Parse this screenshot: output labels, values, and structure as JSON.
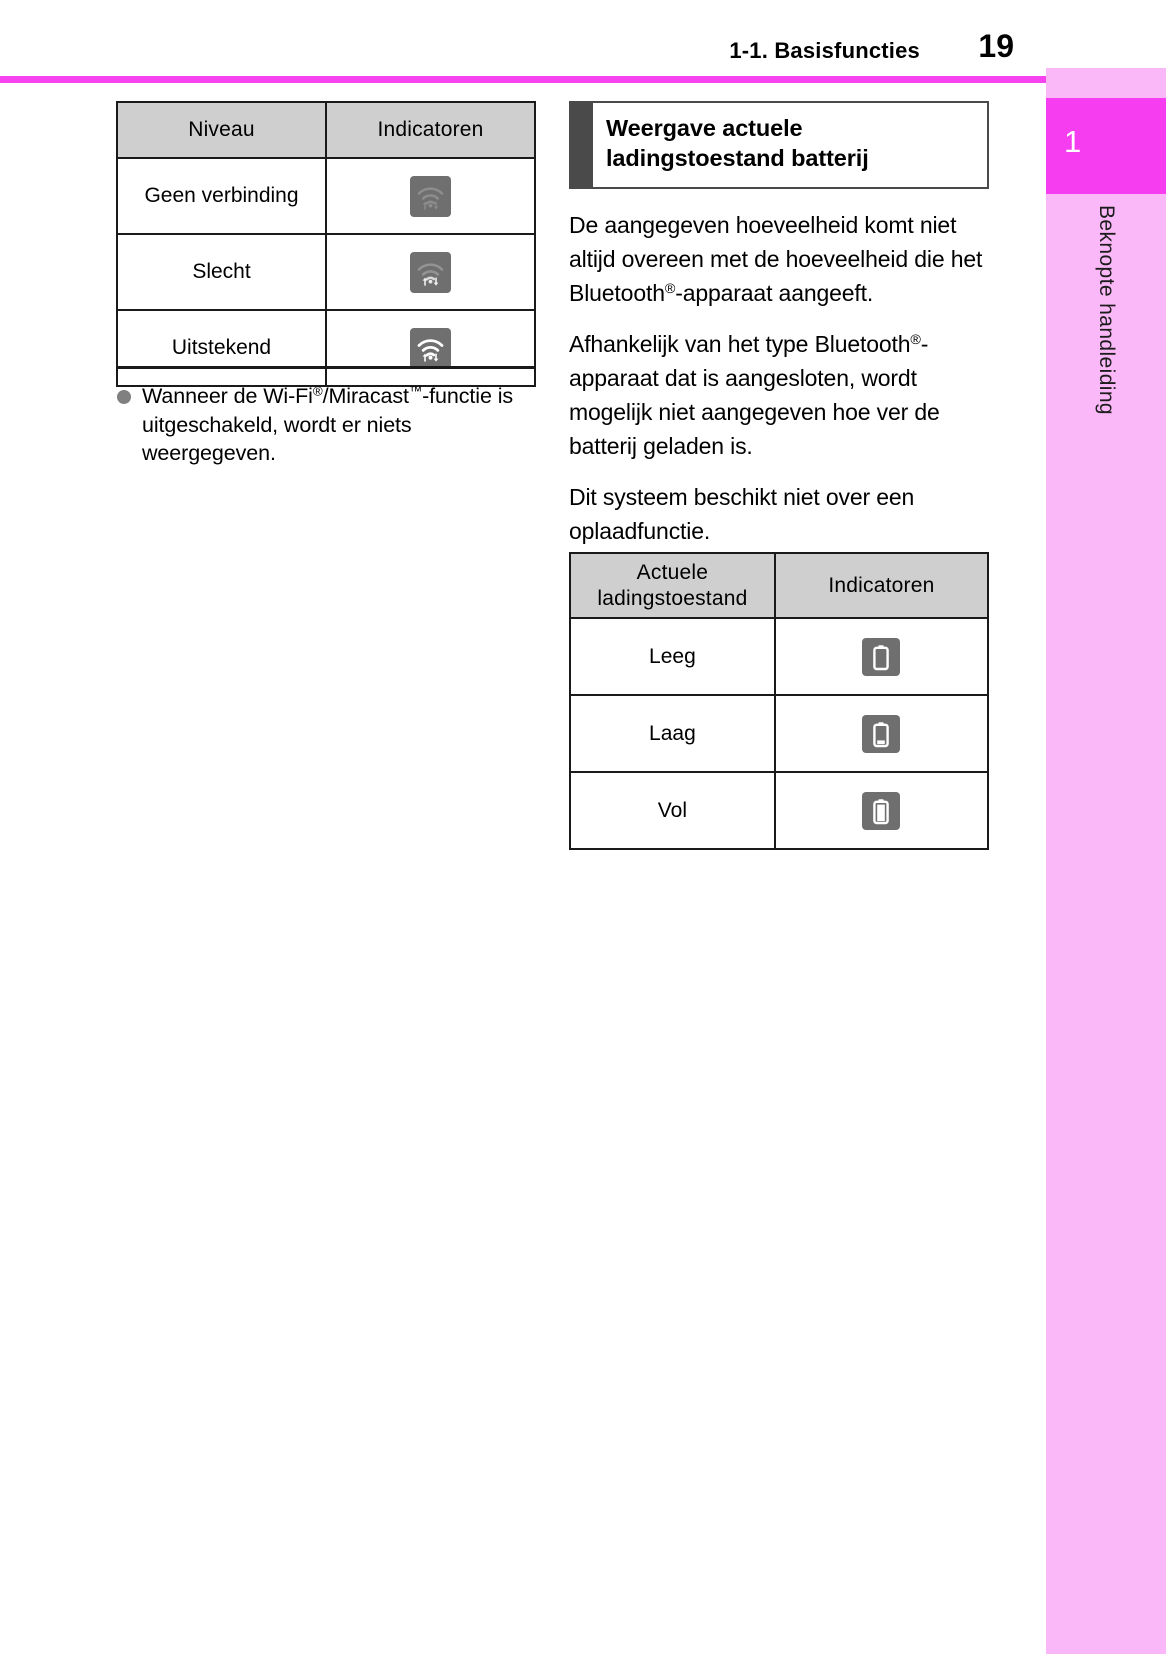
{
  "header": {
    "title": "1-1. Basisfuncties",
    "page_number": "19"
  },
  "sidebar": {
    "chapter_number": "1",
    "chapter_label": "Beknopte handleiding",
    "tab_color": "#f73df0",
    "strip_color": "#fbb8f8"
  },
  "left_column": {
    "table": {
      "headers": [
        "Niveau",
        "Indicatoren"
      ],
      "rows": [
        {
          "level": "Geen verbinding",
          "icon": "wifi-no-connection-icon",
          "bars": 0
        },
        {
          "level": "Slecht",
          "icon": "wifi-weak-icon",
          "bars": 1
        },
        {
          "level": "Uitstekend",
          "icon": "wifi-excellent-icon",
          "bars": 3
        }
      ]
    },
    "footnote": {
      "bullet_icon": "bullet-dot-icon",
      "text_part1": "Wanneer de Wi-Fi",
      "reg1": "®",
      "text_part2": "/Miracast",
      "tm": "™",
      "text_part3": "-functie is uitgeschakeld, wordt er niets weergegeven."
    }
  },
  "right_column": {
    "heading": "Weergave actuele ladingstoestand batterij",
    "paragraphs": [
      {
        "before": "De aangegeven hoeveelheid komt niet altijd overeen met de hoeveelheid die het Bluetooth",
        "reg": "®",
        "after": "-apparaat aangeeft."
      },
      {
        "before": "Afhankelijk van het type Bluetooth",
        "reg": "®",
        "after": "-apparaat dat is aangesloten, wordt mogelijk niet aangegeven hoe ver de batterij geladen is."
      },
      {
        "before": "Dit systeem beschikt niet over een oplaadfunctie.",
        "reg": "",
        "after": ""
      }
    ],
    "table": {
      "headers": [
        "Actuele ladingstoestand",
        "Indicatoren"
      ],
      "rows": [
        {
          "state": "Leeg",
          "icon": "battery-empty-icon",
          "fill": 0
        },
        {
          "state": "Laag",
          "icon": "battery-low-icon",
          "fill": 25
        },
        {
          "state": "Vol",
          "icon": "battery-full-icon",
          "fill": 100
        }
      ]
    }
  },
  "colors": {
    "accent_magenta": "#f743ef",
    "table_header_grey": "#cfcfcf",
    "icon_tile_grey": "#6f6f6f"
  }
}
